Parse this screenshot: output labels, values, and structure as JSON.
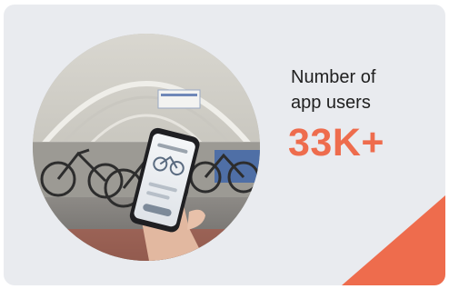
{
  "stat": {
    "label_line1": "Number of",
    "label_line2": "app users",
    "value": "33K+"
  },
  "colors": {
    "card_background": "#e9ebef",
    "accent": "#ee6c4d",
    "text": "#1f1f1f"
  },
  "photo": {
    "subject": "hand-holding-phone-bike-app-icon"
  }
}
